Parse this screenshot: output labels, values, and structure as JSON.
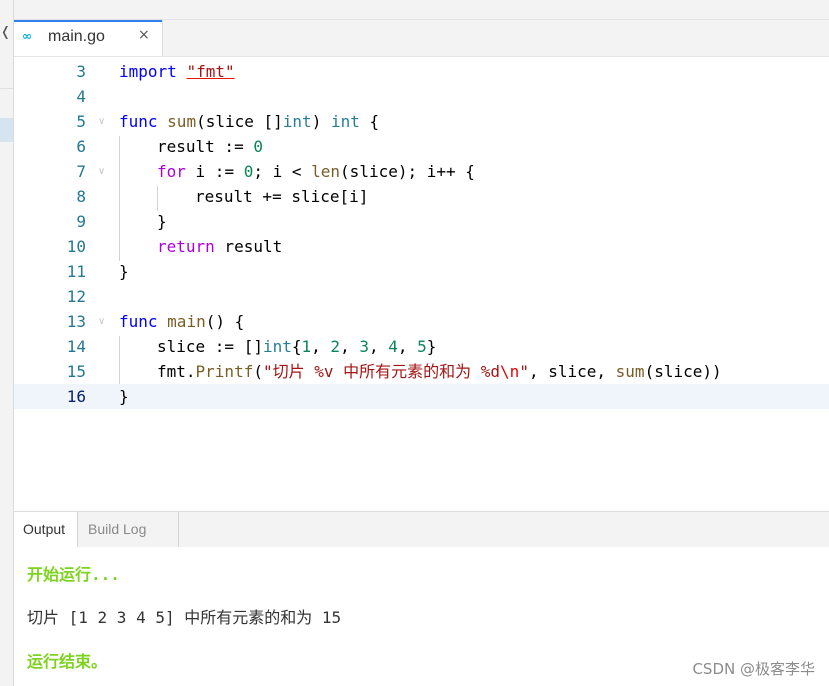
{
  "editor": {
    "tab": {
      "filename": "main.go",
      "icon": "go-file-icon",
      "close": "×"
    },
    "current_line": 16,
    "lines": [
      {
        "num": "3"
      },
      {
        "num": "4"
      },
      {
        "num": "5"
      },
      {
        "num": "6"
      },
      {
        "num": "7"
      },
      {
        "num": "8"
      },
      {
        "num": "9"
      },
      {
        "num": "10"
      },
      {
        "num": "11"
      },
      {
        "num": "12"
      },
      {
        "num": "13"
      },
      {
        "num": "14"
      },
      {
        "num": "15"
      },
      {
        "num": "16"
      }
    ],
    "tokens": {
      "import_kw": "import",
      "import_path": "\"fmt\"",
      "func_kw": "func",
      "sum_name": "sum",
      "sum_params": "(slice []",
      "int_type": "int",
      "sum_params_close": ")",
      "open_brace": "{",
      "close_brace": "}",
      "result_decl": "result := ",
      "zero": "0",
      "for_kw": "for",
      "for_init": " i := ",
      "for_cond": "; i < ",
      "len_fn": "len",
      "for_rest": "(slice); i++ {",
      "loop_body": "result += slice[i]",
      "return_kw": "return",
      "return_val": " result",
      "main_name": "main",
      "main_sig": "() {",
      "slice_decl": "slice := []",
      "lit_open": "{",
      "n1": "1",
      "n2": "2",
      "n3": "3",
      "n4": "4",
      "n5": "5",
      "comma": ", ",
      "lit_close": "}",
      "fmt_pkg": "fmt.",
      "printf_fn": "Printf",
      "paren_open": "(",
      "fmt_string": "\"切片 %v 中所有元素的和为 %d",
      "fmt_escape": "\\n",
      "quote": "\"",
      "printf_args": ", slice, ",
      "sum_call_arg": "(slice))"
    }
  },
  "panel": {
    "tabs": [
      {
        "label": "Output",
        "active": true
      },
      {
        "label": "Build Log",
        "active": false
      }
    ],
    "output": {
      "start": "开始运行...",
      "result": "切片 [1 2 3 4 5] 中所有元素的和为 15",
      "end": "运行结束。"
    }
  },
  "watermark": "CSDN @极客李华",
  "colors": {
    "keyword": "#0000ff",
    "control_keyword": "#af00db",
    "function": "#795e26",
    "type": "#267f99",
    "number": "#098658",
    "string": "#a31515",
    "output_status": "#7ed321",
    "tab_accent": "#2f80ed"
  }
}
